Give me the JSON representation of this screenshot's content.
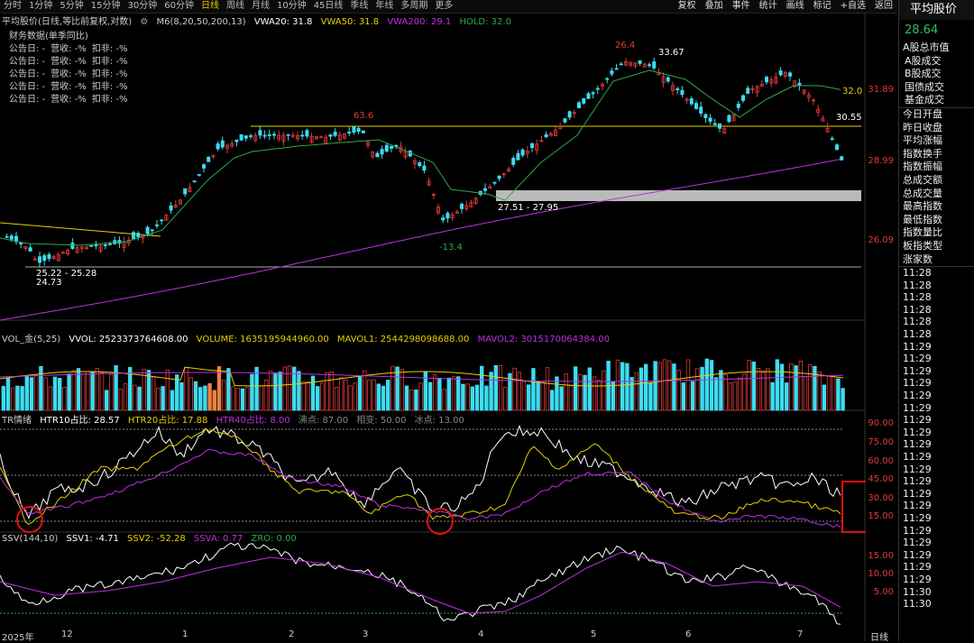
{
  "topbar": {
    "timeframes": [
      "分时",
      "1分钟",
      "5分钟",
      "15分钟",
      "30分钟",
      "60分钟",
      "日线",
      "周线",
      "月线",
      "10分钟",
      "45日线",
      "季线",
      "年线",
      "多周期",
      "更多"
    ],
    "active": "日线",
    "right_buttons": [
      "复权",
      "叠加",
      "事件",
      "统计",
      "画线",
      "标记",
      "+自选",
      "返回"
    ]
  },
  "main": {
    "title": "平均股价(日线,等比前复权,对数)",
    "indicator": "M6(8,20,50,200,13)",
    "vwa20": "VWA20: 31.8",
    "vwa50": "VWA50: 31.8",
    "vwa200": "VWA200: 29.1",
    "hold": "HOLD: 32.0",
    "fin_title": "财务数据(单季同比)",
    "fin_rows": [
      [
        "公告日: -",
        "营收: -%",
        "扣非: -%"
      ],
      [
        "公告日: -",
        "营收: -%",
        "扣非: -%"
      ],
      [
        "公告日: -",
        "营收: -%",
        "扣非: -%"
      ],
      [
        "公告日: -",
        "营收: -%",
        "扣非: -%"
      ],
      [
        "公告日: -",
        "营收: -%",
        "扣非: -%"
      ]
    ],
    "annotations": {
      "low1": "25.22 - 25.28",
      "low1b": "24.73",
      "peak1": "63.6",
      "low2": "-13.4",
      "range2": "27.51 - 27.95",
      "peak2": "26.4",
      "peak2b": "33.67",
      "hold_val": "32.0",
      "last": "30.55"
    },
    "price_axis": [
      "31.89",
      "28.99",
      "26.09"
    ]
  },
  "volume": {
    "label": "VOL_金(5,25)",
    "vvol": "VVOL: 2523373764608.00",
    "volume": "VOLUME: 1635195944960.00",
    "mavol1": "MAVOL1: 2544298098688.00",
    "mavol2": "MAVOL2: 3015170064384.00"
  },
  "tr": {
    "label": "TR情绪",
    "htr10": "HTR10占比: 28.57",
    "htr20": "HTR20占比: 17.88",
    "htr40": "HTR40占比: 8.00",
    "hot": "沸点: 87.00",
    "mid": "相变: 50.00",
    "ice": "冰点: 13.00",
    "axis": [
      "90.00",
      "75.00",
      "60.00",
      "45.00",
      "30.00",
      "15.00"
    ]
  },
  "ssv": {
    "label": "SSV(144,10)",
    "ssv1": "SSV1: -4.71",
    "ssv2": "SSV2: -52.28",
    "ssva": "SSVA: 0.77",
    "zro": "ZRO: 0.00",
    "axis": [
      "15.00",
      "10.00",
      "5.00"
    ]
  },
  "xaxis": [
    "2025年",
    "12",
    "1",
    "2",
    "3",
    "4",
    "5",
    "6",
    "7"
  ],
  "sidebar": {
    "title": "平均股价",
    "price": "28.64",
    "items": [
      "A股总市值",
      "A股成交",
      "B股成交",
      "国债成交",
      "基金成交",
      "今日开盘",
      "昨日收盘",
      "平均涨幅",
      "指数换手",
      "指数振幅",
      "总成交额",
      "总成交量",
      "最高指数",
      "最低指数",
      "指数量比",
      "板指类型",
      "涨家数"
    ],
    "times": [
      "11:28",
      "11:28",
      "11:28",
      "11:28",
      "11:28",
      "11:28",
      "11:29",
      "11:29",
      "11:29",
      "11:29",
      "11:29",
      "11:29",
      "11:29",
      "11:29",
      "11:29",
      "11:29",
      "11:29",
      "11:29",
      "11:29",
      "11:29",
      "11:29",
      "11:29",
      "11:29",
      "11:29",
      "11:29",
      "11:29",
      "11:30",
      "11:30"
    ],
    "bottom": "日线"
  },
  "colors": {
    "up": "#e03a3a",
    "down": "#3cdcf0",
    "yellow": "#e6d000",
    "magenta": "#c030e0",
    "green": "#2ea84a",
    "white": "#ffffff"
  }
}
